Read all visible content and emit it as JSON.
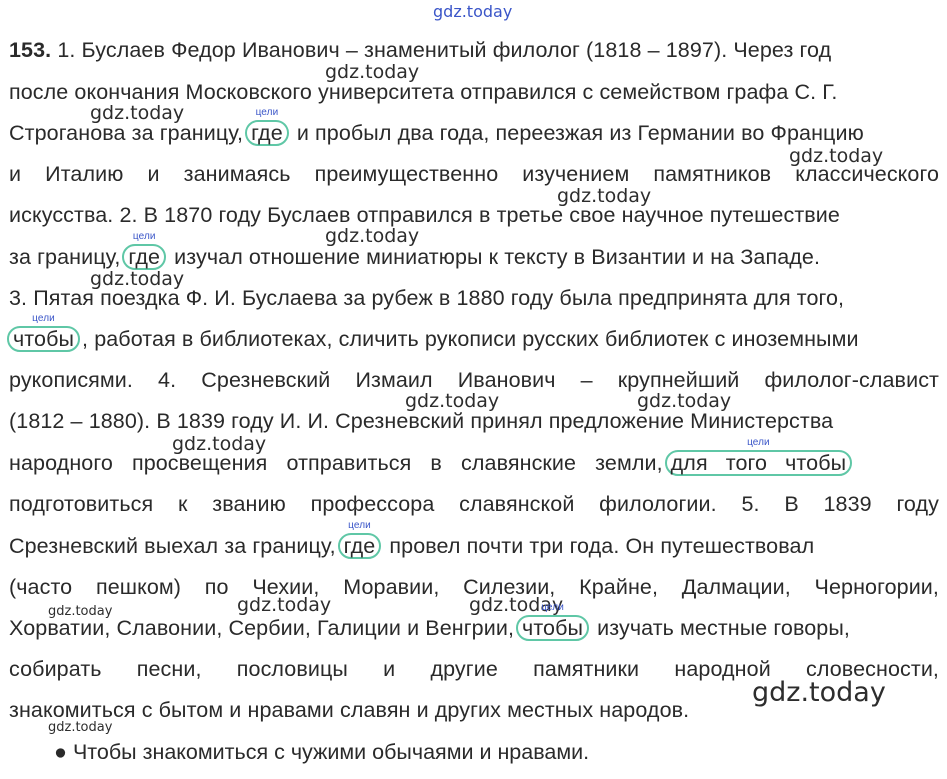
{
  "watermark": "gdz.today",
  "circle_tag": "цели",
  "lines": [
    {
      "num": "153.",
      "before": " 1. Буслаев Федор Иванович – знаменитый филолог (1818 – 1897). Через год"
    },
    {
      "before": "после окончания Московского университета отправился с семейством графа С. Г."
    },
    {
      "before": "Строганова за границу,",
      "circled": "где",
      "after": " и пробыл два года, переезжая из Германии во Францию"
    },
    {
      "before": "и Италию и занимаясь преимущественно изучением памятников классического"
    },
    {
      "before": "искусства. 2. В 1870 году Буслаев отправился в третье свое научное путешествие"
    },
    {
      "before": "за границу,",
      "circled": "где",
      "after": " изучал отношение миниатюры к тексту в Византии и на Западе."
    },
    {
      "before": "3. Пятая поездка Ф. И. Буслаева за рубеж в 1880 году была предпринята для того,"
    },
    {
      "before": "",
      "circled": "чтобы",
      "after": ", работая в библиотеках, сличить рукописи русских библиотек с иноземными"
    },
    {
      "before": "рукописями. 4. Срезневский Измаил Иванович – крупнейший филолог-славист"
    },
    {
      "before": "(1812 – 1880). В 1839 году И. И. Срезневский принял предложение Министерства"
    },
    {
      "before": "народного просвещения отправиться в славянские земли,",
      "circled": "для того чтобы",
      "after": ""
    },
    {
      "before": "подготовиться к званию профессора славянской филологии. 5. В 1839 году"
    },
    {
      "before": "Срезневский выехал за границу,",
      "circled": "где",
      "after": " провел почти три года. Он путешествовал"
    },
    {
      "before": "(часто пешком) по Чехии, Моравии, Силезии, Крайне, Далмации, Черногории,"
    },
    {
      "before": "Хорватии, Славонии, Сербии, Галиции и Венгрии,",
      "circled": "чтобы",
      "after": " изучать местные говоры,"
    },
    {
      "before": "собирать песни, пословицы и другие памятники народной словесности,"
    },
    {
      "before": "знакомиться с бытом и нравами славян и других местных народов."
    }
  ],
  "bullet": "● Чтобы знакомиться с чужими обычаями и нравами."
}
